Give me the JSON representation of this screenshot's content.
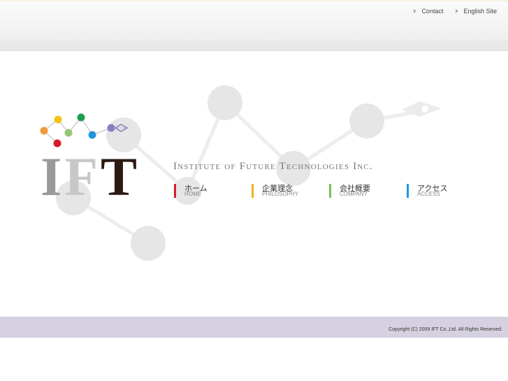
{
  "header": {
    "links": [
      {
        "label": "Contact"
      },
      {
        "label": "English Site"
      }
    ]
  },
  "logo": {
    "wordmark": [
      "I",
      "F",
      "T"
    ]
  },
  "company": {
    "name": "Institute of Future Technologies Inc."
  },
  "nav": {
    "items": [
      {
        "jp": "ホーム",
        "en": "HOME",
        "color": "#d4202f"
      },
      {
        "jp": "企業理念",
        "en": "PHILOSOPHY",
        "color": "#f0b21c"
      },
      {
        "jp": "会社概要",
        "en": "COMPANY",
        "color": "#7bbf5a"
      },
      {
        "jp": "アクセス",
        "en": "ACCESS",
        "color": "#1d9be0"
      }
    ]
  },
  "footer": {
    "copyright": "Copyright (C) 2009 IFT Co.,Ltd. All Rights Reserved."
  }
}
